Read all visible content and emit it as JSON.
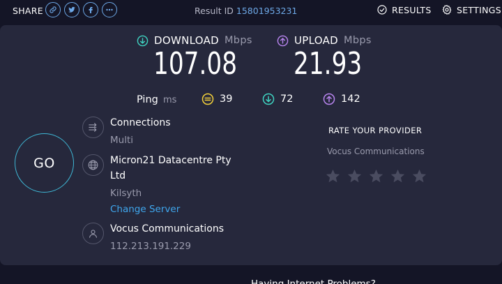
{
  "share": {
    "label": "SHARE",
    "icons": [
      "link-icon",
      "twitter-icon",
      "facebook-icon",
      "more-icon"
    ]
  },
  "result": {
    "label": "Result ID",
    "id": "15801953231"
  },
  "nav": {
    "results_label": "RESULTS",
    "settings_label": "SETTINGS"
  },
  "download": {
    "label": "DOWNLOAD",
    "unit": "Mbps",
    "value": "107.08"
  },
  "upload": {
    "label": "UPLOAD",
    "unit": "Mbps",
    "value": "21.93"
  },
  "ping": {
    "label": "Ping",
    "unit": "ms",
    "idle": "39",
    "download": "72",
    "upload": "142"
  },
  "go_label": "GO",
  "connections": {
    "title": "Connections",
    "value": "Multi"
  },
  "server": {
    "title_line1": "Micron21 Datacentre Pty",
    "title_line2": "Ltd",
    "location": "Kilsyth",
    "change_label": "Change Server"
  },
  "isp": {
    "title": "Vocus Communications",
    "ip": "112.213.191.229"
  },
  "rate": {
    "title": "RATE YOUR PROVIDER",
    "provider": "Vocus Communications",
    "stars_filled": 0,
    "stars_total": 5
  },
  "bottom": {
    "text": "Having Internet Problems?"
  },
  "colors": {
    "background": "#141526",
    "panel": "#26283c",
    "download_accent": "#3fd3c1",
    "upload_accent": "#b985f0",
    "ping_idle": "#f5d23a",
    "link": "#3fa7ee"
  }
}
